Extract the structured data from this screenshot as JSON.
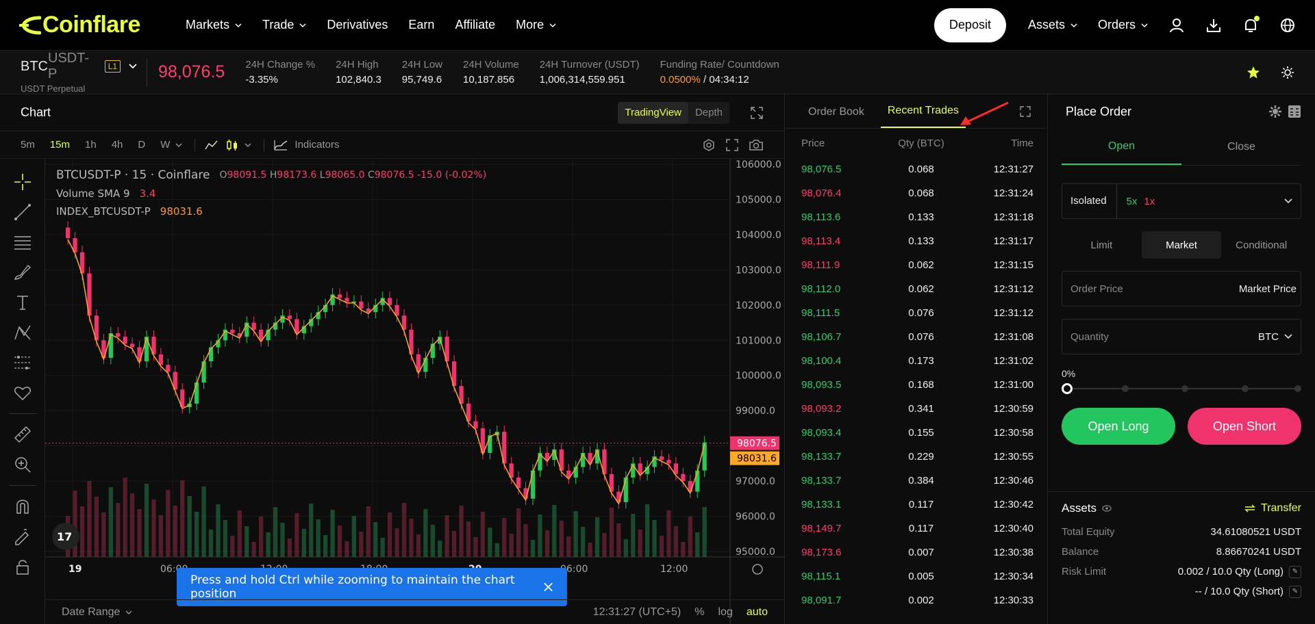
{
  "nav": {
    "logo": "Coinflare",
    "links": [
      {
        "label": "Markets",
        "dropdown": true
      },
      {
        "label": "Trade",
        "dropdown": true
      },
      {
        "label": "Derivatives",
        "dropdown": false
      },
      {
        "label": "Earn",
        "dropdown": false
      },
      {
        "label": "Affiliate",
        "dropdown": false
      },
      {
        "label": "More",
        "dropdown": true
      }
    ],
    "deposit": "Deposit",
    "assets": "Assets",
    "orders": "Orders"
  },
  "ticker": {
    "base": "BTC",
    "quote": "USDT-P",
    "sub": "USDT Perpetual",
    "level": "L1",
    "last_price": "98,076.5",
    "stats": [
      {
        "k": "24H Change %",
        "v": "-3.35%",
        "cls": "neg"
      },
      {
        "k": "24H High",
        "v": "102,840.3",
        "cls": ""
      },
      {
        "k": "24H Low",
        "v": "95,749.6",
        "cls": ""
      },
      {
        "k": "24H Volume",
        "v": "10,187.856",
        "cls": ""
      },
      {
        "k": "24H Turnover (USDT)",
        "v": "1,006,314,559.951",
        "cls": ""
      }
    ],
    "funding_label": "Funding Rate/ Countdown",
    "funding_rate": "0.0500%",
    "countdown": " / 04:34:12"
  },
  "chart": {
    "title": "Chart",
    "view_tabs": [
      "TradingView",
      "Depth"
    ],
    "timeframes": [
      "5m",
      "15m",
      "1h",
      "4h",
      "D",
      "W"
    ],
    "active_tf": "15m",
    "indicators": "Indicators",
    "legend_symbol": "BTCUSDT-P · 15 · Coinflare",
    "ohlc": {
      "o": "98091.5",
      "h": "98173.6",
      "l": "98065.0",
      "c": "98076.5",
      "chg": "-15.0 (-0.02%)"
    },
    "volume_sma": "Volume SMA 9",
    "volume_sma_val": "3.4",
    "index_label": "INDEX_BTCUSDT-P",
    "index_val": "98031.6",
    "price_tag": "98076.5",
    "index_tag": "98031.6",
    "toast": "Press and hold Ctrl while zooming to maintain the chart position",
    "date_range": "Date Range",
    "clock": "12:31:27 (UTC+5)",
    "pct": "%",
    "log": "log",
    "auto": "auto"
  },
  "chart_data": {
    "type": "line",
    "title": "",
    "ylim": [
      95000,
      106000
    ],
    "yticks": [
      "106000.0",
      "105000.0",
      "104000.0",
      "103000.0",
      "102000.0",
      "101000.0",
      "100000.0",
      "99000.0",
      "98000.0",
      "97000.0",
      "96000.0",
      "95000.0"
    ],
    "xticks": [
      "19",
      "06:00",
      "12:00",
      "18:00",
      "20",
      "06:00",
      "12:00"
    ],
    "series": [
      {
        "values": [
          103900,
          103500,
          102900,
          101700,
          101000,
          100500,
          101200,
          101100,
          100900,
          100800,
          100400,
          101100,
          100600,
          100300,
          100100,
          99600,
          99100,
          99200,
          99800,
          100400,
          100800,
          101000,
          101300,
          101200,
          101100,
          101500,
          101300,
          101000,
          101300,
          101500,
          101700,
          101600,
          101200,
          101400,
          101600,
          101800,
          102000,
          102300,
          102200,
          102100,
          102100,
          101900,
          101800,
          102000,
          102200,
          102000,
          101700,
          101300,
          100600,
          100100,
          100500,
          100900,
          101100,
          100400,
          99700,
          99200,
          98700,
          98500,
          97800,
          98300,
          98400,
          97500,
          97100,
          96800,
          96500,
          97300,
          97800,
          97600,
          97900,
          97300,
          97100,
          97400,
          97800,
          97500,
          97900,
          97200,
          96700,
          96400,
          97100,
          97500,
          97200,
          97400,
          97700,
          97600,
          97500,
          97200,
          97000,
          96700,
          97300,
          98100
        ]
      }
    ]
  },
  "trades": {
    "tabs": [
      "Order Book",
      "Recent Trades"
    ],
    "active": "Recent Trades",
    "headers": [
      "Price",
      "Qty (BTC)",
      "Time"
    ],
    "rows": [
      {
        "p": "98,076.5",
        "q": "0.068",
        "t": "12:31:27",
        "side": "pos"
      },
      {
        "p": "98,076.4",
        "q": "0.068",
        "t": "12:31:24",
        "side": "neg"
      },
      {
        "p": "98,113.6",
        "q": "0.133",
        "t": "12:31:18",
        "side": "pos"
      },
      {
        "p": "98,113.4",
        "q": "0.133",
        "t": "12:31:17",
        "side": "neg"
      },
      {
        "p": "98,111.9",
        "q": "0.062",
        "t": "12:31:15",
        "side": "neg"
      },
      {
        "p": "98,112.0",
        "q": "0.062",
        "t": "12:31:12",
        "side": "pos"
      },
      {
        "p": "98,111.5",
        "q": "0.076",
        "t": "12:31:12",
        "side": "pos"
      },
      {
        "p": "98,106.7",
        "q": "0.076",
        "t": "12:31:08",
        "side": "pos"
      },
      {
        "p": "98,100.4",
        "q": "0.173",
        "t": "12:31:02",
        "side": "pos"
      },
      {
        "p": "98,093.5",
        "q": "0.168",
        "t": "12:31:00",
        "side": "pos"
      },
      {
        "p": "98,093.2",
        "q": "0.341",
        "t": "12:30:59",
        "side": "neg"
      },
      {
        "p": "98,093.4",
        "q": "0.155",
        "t": "12:30:58",
        "side": "pos"
      },
      {
        "p": "98,133.7",
        "q": "0.229",
        "t": "12:30:55",
        "side": "pos"
      },
      {
        "p": "98,133.7",
        "q": "0.384",
        "t": "12:30:46",
        "side": "pos"
      },
      {
        "p": "98,133.1",
        "q": "0.117",
        "t": "12:30:42",
        "side": "pos"
      },
      {
        "p": "98,149.7",
        "q": "0.117",
        "t": "12:30:40",
        "side": "neg"
      },
      {
        "p": "98,173.6",
        "q": "0.007",
        "t": "12:30:38",
        "side": "neg"
      },
      {
        "p": "98,115.1",
        "q": "0.005",
        "t": "12:30:34",
        "side": "pos"
      },
      {
        "p": "98,091.7",
        "q": "0.002",
        "t": "12:30:33",
        "side": "pos"
      }
    ]
  },
  "order": {
    "title": "Place Order",
    "tabs": [
      "Open",
      "Close"
    ],
    "margin_mode": "Isolated",
    "lev_long": "5x",
    "lev_short": "1x",
    "types": [
      "Limit",
      "Market",
      "Conditional"
    ],
    "active_type": "Market",
    "price_label": "Order Price",
    "price_value": "Market Price",
    "qty_label": "Quantity",
    "qty_unit": "BTC",
    "pct": "0%",
    "open_long": "Open Long",
    "open_short": "Open Short"
  },
  "assets": {
    "title": "Assets",
    "transfer": "Transfer",
    "rows": [
      {
        "k": "Total Equity",
        "v": "34.61080521 USDT"
      },
      {
        "k": "Balance",
        "v": "8.86670241 USDT"
      },
      {
        "k": "Risk Limit",
        "v": "0.002 / 10.0 Qty (Long)"
      },
      {
        "k": "",
        "v": "-- / 10.0 Qty (Short)"
      }
    ]
  },
  "colors": {
    "accent": "#e8ff3a",
    "up": "#2ecc71",
    "down": "#ff3d6e"
  }
}
